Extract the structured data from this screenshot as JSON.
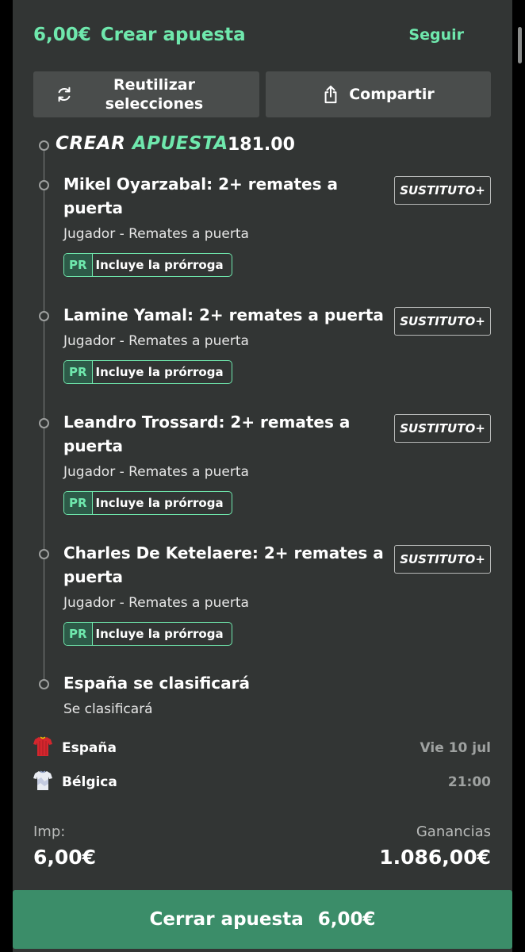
{
  "header": {
    "stake": "6,00€",
    "title": "Crear apuesta",
    "follow_label": "Seguir"
  },
  "actions": {
    "reuse_label_line1": "Reutilizar",
    "reuse_label_line2": "selecciones",
    "share_label": "Compartir"
  },
  "builder": {
    "title_word1": "CREAR",
    "title_word2": "APUESTA",
    "odds": "181.00"
  },
  "selections": [
    {
      "title": "Mikel Oyarzabal: 2+ remates a puerta",
      "market": "Jugador - Remates a puerta",
      "badge_code": "PR",
      "badge_text": "Incluye la prórroga",
      "sub_label": "SUSTITUTO+"
    },
    {
      "title": "Lamine Yamal: 2+ remates a puerta",
      "market": "Jugador - Remates a puerta",
      "badge_code": "PR",
      "badge_text": "Incluye la prórroga",
      "sub_label": "SUSTITUTO+"
    },
    {
      "title": "Leandro Trossard: 2+ remates a puerta",
      "market": "Jugador - Remates a puerta",
      "badge_code": "PR",
      "badge_text": "Incluye la prórroga",
      "sub_label": "SUSTITUTO+"
    },
    {
      "title": "Charles De Ketelaere: 2+ remates a puerta",
      "market": "Jugador - Remates a puerta",
      "badge_code": "PR",
      "badge_text": "Incluye la prórroga",
      "sub_label": "SUSTITUTO+"
    },
    {
      "title": "España se clasificará",
      "market": "Se clasificará"
    }
  ],
  "match": {
    "home": {
      "name": "España",
      "icon": "spain-kit-icon",
      "meta": "Vie 10 jul"
    },
    "away": {
      "name": "Bélgica",
      "icon": "belgium-kit-icon",
      "meta": "21:00"
    }
  },
  "footer": {
    "stake_label": "Imp:",
    "stake_value": "6,00€",
    "returns_label": "Ganancias",
    "returns_value": "1.086,00€",
    "place_label": "Cerrar apuesta",
    "place_amount": "6,00€"
  },
  "colors": {
    "accent": "#6fe8ad",
    "panel": "#323534",
    "button": "#4a4d4c",
    "place_button": "#3b8d69"
  }
}
